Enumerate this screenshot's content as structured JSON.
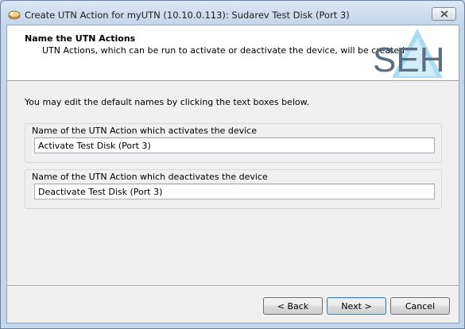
{
  "window": {
    "title": "Create UTN Action for myUTN (10.10.0.113): Sudarev Test Disk (Port 3)"
  },
  "header": {
    "title": "Name the UTN Actions",
    "subtitle": "UTN Actions, which can be run to activate or deactivate the device, will be created.",
    "logo_text": "SEH"
  },
  "main": {
    "intro": "You may edit the default names by clicking the text boxes below.",
    "activate_group": {
      "label": "Name of the UTN Action which activates the device",
      "value": "Activate Test Disk (Port 3)"
    },
    "deactivate_group": {
      "label": "Name of the UTN Action which deactivates the device",
      "value": "Deactivate Test Disk (Port 3)"
    }
  },
  "buttons": {
    "back": "< Back",
    "next": "Next >",
    "cancel": "Cancel"
  },
  "colors": {
    "logo": "#5a6e80",
    "logo_triangle": "#6ec6e8"
  }
}
